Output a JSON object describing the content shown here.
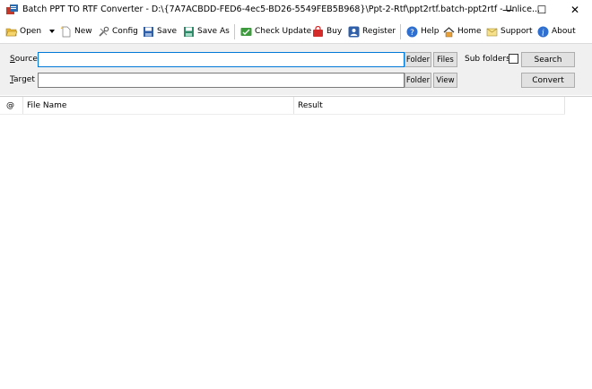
{
  "window": {
    "title": "Batch PPT TO RTF Converter - D:\\{7A7ACBDD-FED6-4ec5-BD26-5549FEB5B968}\\Ppt-2-Rtf\\ppt2rtf.batch-ppt2rtf - Unlice...",
    "minimize_glyph": "—",
    "maximize_glyph": "☐",
    "close_glyph": "✕"
  },
  "toolbar": {
    "open": "Open",
    "new": "New",
    "config": "Config",
    "save": "Save",
    "save_as": "Save As",
    "check_update": "Check Update",
    "buy": "Buy",
    "register": "Register",
    "help": "Help",
    "home": "Home",
    "support": "Support",
    "about": "About"
  },
  "source": {
    "label_underlined": "S",
    "label_rest": "ource",
    "value": "",
    "folder_button": "Folder",
    "files_button": "Files",
    "subfolders_label": "Sub folders",
    "subfolders_checked": false,
    "search_button": "Search"
  },
  "target": {
    "label_underlined": "T",
    "label_rest": "arget",
    "value": "",
    "folder_button": "Folder",
    "view_button": "View",
    "convert_button": "Convert"
  },
  "grid": {
    "columns": [
      "@",
      "File Name",
      "Result"
    ],
    "rows": []
  },
  "colors": {
    "panel_bg": "#f0f0f0",
    "focus_border": "#0078d7",
    "button_bg": "#e1e1e1"
  }
}
